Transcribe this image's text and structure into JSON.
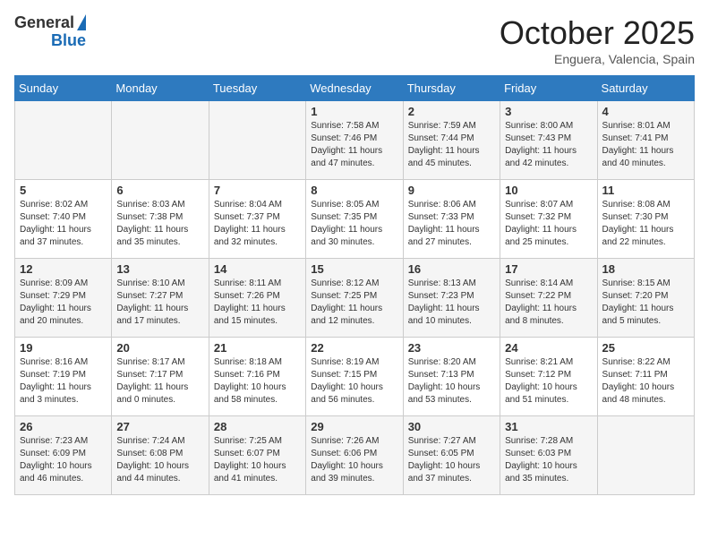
{
  "logo": {
    "general": "General",
    "blue": "Blue"
  },
  "header": {
    "month": "October 2025",
    "location": "Enguera, Valencia, Spain"
  },
  "days_of_week": [
    "Sunday",
    "Monday",
    "Tuesday",
    "Wednesday",
    "Thursday",
    "Friday",
    "Saturday"
  ],
  "weeks": [
    [
      {
        "day": "",
        "info": ""
      },
      {
        "day": "",
        "info": ""
      },
      {
        "day": "",
        "info": ""
      },
      {
        "day": "1",
        "info": "Sunrise: 7:58 AM\nSunset: 7:46 PM\nDaylight: 11 hours\nand 47 minutes."
      },
      {
        "day": "2",
        "info": "Sunrise: 7:59 AM\nSunset: 7:44 PM\nDaylight: 11 hours\nand 45 minutes."
      },
      {
        "day": "3",
        "info": "Sunrise: 8:00 AM\nSunset: 7:43 PM\nDaylight: 11 hours\nand 42 minutes."
      },
      {
        "day": "4",
        "info": "Sunrise: 8:01 AM\nSunset: 7:41 PM\nDaylight: 11 hours\nand 40 minutes."
      }
    ],
    [
      {
        "day": "5",
        "info": "Sunrise: 8:02 AM\nSunset: 7:40 PM\nDaylight: 11 hours\nand 37 minutes."
      },
      {
        "day": "6",
        "info": "Sunrise: 8:03 AM\nSunset: 7:38 PM\nDaylight: 11 hours\nand 35 minutes."
      },
      {
        "day": "7",
        "info": "Sunrise: 8:04 AM\nSunset: 7:37 PM\nDaylight: 11 hours\nand 32 minutes."
      },
      {
        "day": "8",
        "info": "Sunrise: 8:05 AM\nSunset: 7:35 PM\nDaylight: 11 hours\nand 30 minutes."
      },
      {
        "day": "9",
        "info": "Sunrise: 8:06 AM\nSunset: 7:33 PM\nDaylight: 11 hours\nand 27 minutes."
      },
      {
        "day": "10",
        "info": "Sunrise: 8:07 AM\nSunset: 7:32 PM\nDaylight: 11 hours\nand 25 minutes."
      },
      {
        "day": "11",
        "info": "Sunrise: 8:08 AM\nSunset: 7:30 PM\nDaylight: 11 hours\nand 22 minutes."
      }
    ],
    [
      {
        "day": "12",
        "info": "Sunrise: 8:09 AM\nSunset: 7:29 PM\nDaylight: 11 hours\nand 20 minutes."
      },
      {
        "day": "13",
        "info": "Sunrise: 8:10 AM\nSunset: 7:27 PM\nDaylight: 11 hours\nand 17 minutes."
      },
      {
        "day": "14",
        "info": "Sunrise: 8:11 AM\nSunset: 7:26 PM\nDaylight: 11 hours\nand 15 minutes."
      },
      {
        "day": "15",
        "info": "Sunrise: 8:12 AM\nSunset: 7:25 PM\nDaylight: 11 hours\nand 12 minutes."
      },
      {
        "day": "16",
        "info": "Sunrise: 8:13 AM\nSunset: 7:23 PM\nDaylight: 11 hours\nand 10 minutes."
      },
      {
        "day": "17",
        "info": "Sunrise: 8:14 AM\nSunset: 7:22 PM\nDaylight: 11 hours\nand 8 minutes."
      },
      {
        "day": "18",
        "info": "Sunrise: 8:15 AM\nSunset: 7:20 PM\nDaylight: 11 hours\nand 5 minutes."
      }
    ],
    [
      {
        "day": "19",
        "info": "Sunrise: 8:16 AM\nSunset: 7:19 PM\nDaylight: 11 hours\nand 3 minutes."
      },
      {
        "day": "20",
        "info": "Sunrise: 8:17 AM\nSunset: 7:17 PM\nDaylight: 11 hours\nand 0 minutes."
      },
      {
        "day": "21",
        "info": "Sunrise: 8:18 AM\nSunset: 7:16 PM\nDaylight: 10 hours\nand 58 minutes."
      },
      {
        "day": "22",
        "info": "Sunrise: 8:19 AM\nSunset: 7:15 PM\nDaylight: 10 hours\nand 56 minutes."
      },
      {
        "day": "23",
        "info": "Sunrise: 8:20 AM\nSunset: 7:13 PM\nDaylight: 10 hours\nand 53 minutes."
      },
      {
        "day": "24",
        "info": "Sunrise: 8:21 AM\nSunset: 7:12 PM\nDaylight: 10 hours\nand 51 minutes."
      },
      {
        "day": "25",
        "info": "Sunrise: 8:22 AM\nSunset: 7:11 PM\nDaylight: 10 hours\nand 48 minutes."
      }
    ],
    [
      {
        "day": "26",
        "info": "Sunrise: 7:23 AM\nSunset: 6:09 PM\nDaylight: 10 hours\nand 46 minutes."
      },
      {
        "day": "27",
        "info": "Sunrise: 7:24 AM\nSunset: 6:08 PM\nDaylight: 10 hours\nand 44 minutes."
      },
      {
        "day": "28",
        "info": "Sunrise: 7:25 AM\nSunset: 6:07 PM\nDaylight: 10 hours\nand 41 minutes."
      },
      {
        "day": "29",
        "info": "Sunrise: 7:26 AM\nSunset: 6:06 PM\nDaylight: 10 hours\nand 39 minutes."
      },
      {
        "day": "30",
        "info": "Sunrise: 7:27 AM\nSunset: 6:05 PM\nDaylight: 10 hours\nand 37 minutes."
      },
      {
        "day": "31",
        "info": "Sunrise: 7:28 AM\nSunset: 6:03 PM\nDaylight: 10 hours\nand 35 minutes."
      },
      {
        "day": "",
        "info": ""
      }
    ]
  ]
}
